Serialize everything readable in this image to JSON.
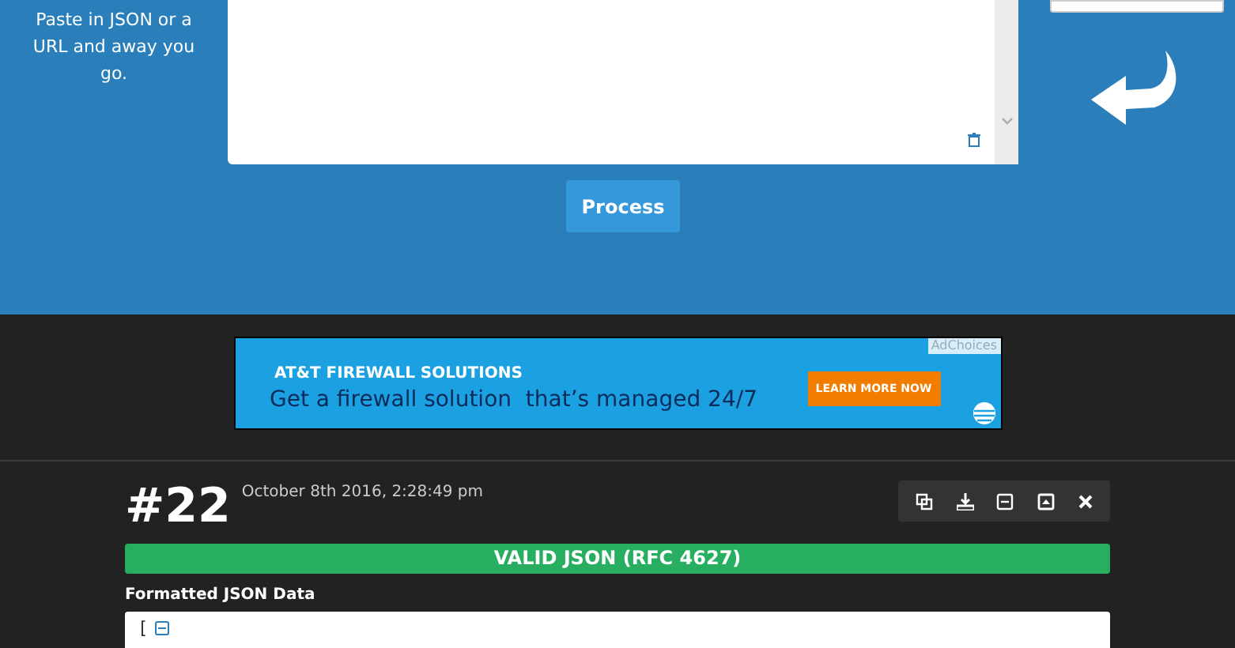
{
  "intro": {
    "text": "Paste in JSON or a URL and away you go."
  },
  "process_button": {
    "label": "Process"
  },
  "ad": {
    "ad_choices": "AdChoices",
    "headline": "AT&T FIREWALL SOLUTIONS",
    "tagline": "Get a firewall solution  that’s managed 24/7",
    "cta": "LEARN MORE NOW"
  },
  "result": {
    "number": "#22",
    "timestamp": "October 8th 2016, 2:28:49 pm",
    "status": "VALID JSON (RFC 4627)",
    "section_label": "Formatted JSON Data",
    "first_line": "["
  }
}
